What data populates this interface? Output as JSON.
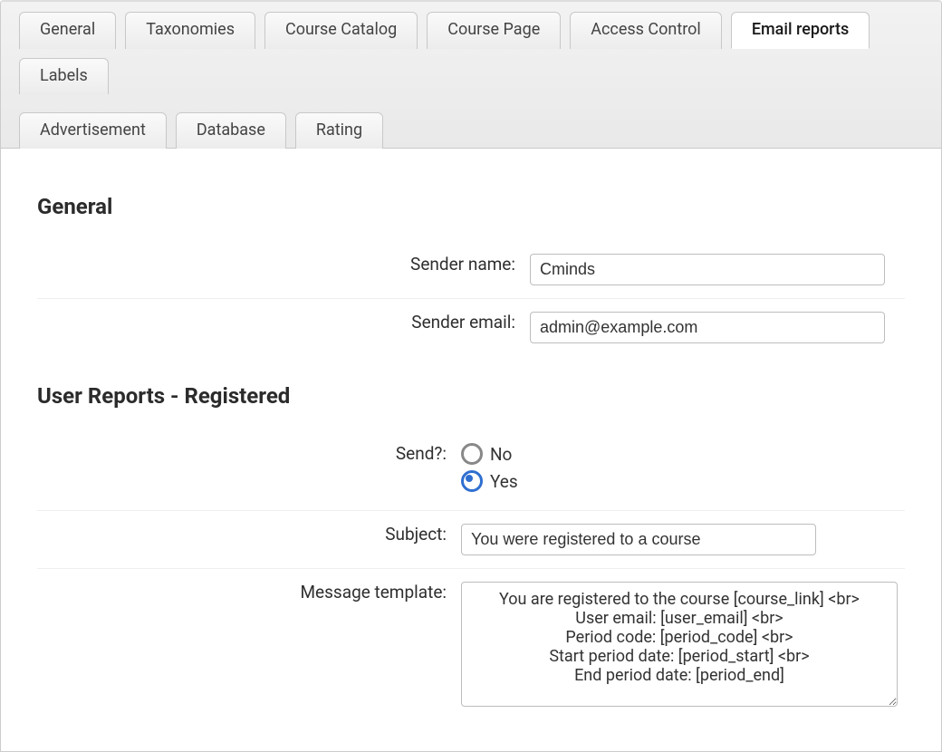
{
  "tabs": {
    "row1": [
      {
        "label": "General"
      },
      {
        "label": "Taxonomies"
      },
      {
        "label": "Course Catalog"
      },
      {
        "label": "Course Page"
      },
      {
        "label": "Access Control"
      },
      {
        "label": "Email reports"
      },
      {
        "label": "Labels"
      }
    ],
    "row2": [
      {
        "label": "Advertisement"
      },
      {
        "label": "Database"
      },
      {
        "label": "Rating"
      }
    ],
    "active": "Email reports"
  },
  "sections": {
    "general": {
      "title": "General",
      "sender_name_label": "Sender name:",
      "sender_name_value": "Cminds",
      "sender_email_label": "Sender email:",
      "sender_email_value": "admin@example.com"
    },
    "user_reports": {
      "title": "User Reports - Registered",
      "send_label": "Send?:",
      "send_no": "No",
      "send_yes": "Yes",
      "send_value": "Yes",
      "subject_label": "Subject:",
      "subject_value": "You were registered to a course",
      "template_label": "Message template:",
      "template_value": "You are registered to the course [course_link] <br>\nUser email: [user_email] <br>\nPeriod code: [period_code] <br>\nStart period date: [period_start] <br>\nEnd period date: [period_end]"
    }
  }
}
